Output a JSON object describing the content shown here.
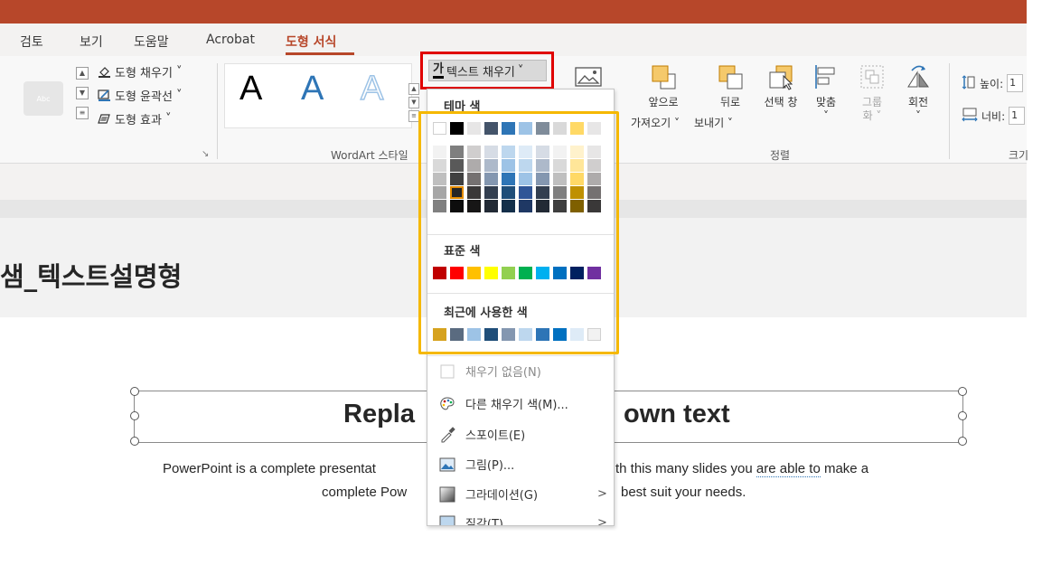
{
  "ribbon": {
    "tabs": [
      "검토",
      "보기",
      "도움말",
      "Acrobat",
      "도형 서식"
    ],
    "active_tab": "도형 서식",
    "shape_styles": {
      "fill": "도형 채우기",
      "outline": "도형 윤곽선",
      "effects": "도형 효과",
      "thumb": "Abc"
    },
    "wordart": {
      "sample": "A",
      "group_label": "WordArt 스타일"
    },
    "text_fill_button": "텍스트 채우기",
    "text_fill_glyph": "가",
    "arrange": {
      "bring_forward_1": "앞으로",
      "bring_forward_2": "가져오기 ˅",
      "send_backward_1": "뒤로",
      "send_backward_2": "보내기 ˅",
      "selection_pane": "선택 창",
      "align": "맞춤",
      "align_arrow": "˅",
      "group_1": "그룹",
      "group_2": "화 ˅",
      "rotate": "회전",
      "rotate_arrow": "˅",
      "group_label": "정렬"
    },
    "size": {
      "height_label": "높이:",
      "width_label": "너비:",
      "height_value": "1",
      "width_value": "1",
      "group_label": "크기"
    }
  },
  "slide": {
    "title": "샘_텍스트설명형",
    "headline_left": "Repla",
    "headline_right": "own text",
    "body_line1_left": "PowerPoint is a complete presentat",
    "body_line1_right_a": "th this many slides you ",
    "body_line1_right_b": "are able to",
    "body_line1_right_c": " make a",
    "body_line2_left": "complete Pow",
    "body_line2_right": "best suit your needs."
  },
  "dropdown": {
    "theme_colors_label": "테마 색",
    "standard_colors_label": "표준 색",
    "recent_colors_label": "최근에 사용한 색",
    "items": [
      {
        "label": "채우기 없음(N)",
        "icon": "empty-box-icon",
        "enabled": false
      },
      {
        "label": "다른 채우기 색(M)...",
        "icon": "palette-icon",
        "enabled": true
      },
      {
        "label": "스포이트(E)",
        "icon": "eyedropper-icon",
        "enabled": true
      },
      {
        "label": "그림(P)...",
        "icon": "picture-icon",
        "enabled": true
      },
      {
        "label": "그라데이션(G)",
        "icon": "gradient-icon",
        "enabled": true,
        "submenu": true
      },
      {
        "label": "질감(T)",
        "icon": "texture-icon",
        "enabled": true,
        "submenu": true
      }
    ],
    "submenu_arrow": ">",
    "theme_colors": [
      "#ffffff",
      "#000000",
      "#e7e6e6",
      "#44546a",
      "#2e75b6",
      "#9dc3e6",
      "#7f8c9a",
      "#d9d9d9",
      "#ffd966",
      "#e7e6e6"
    ],
    "theme_shades": [
      [
        "#f2f2f2",
        "#d9d9d9",
        "#bfbfbf",
        "#a6a6a6",
        "#808080"
      ],
      [
        "#7f7f7f",
        "#595959",
        "#404040",
        "#262626",
        "#0d0d0d"
      ],
      [
        "#d0cece",
        "#aeabab",
        "#757171",
        "#3a3838",
        "#171616"
      ],
      [
        "#d6dce5",
        "#adb9ca",
        "#8497b0",
        "#333f50",
        "#222a35"
      ],
      [
        "#bdd7ee",
        "#9dc3e6",
        "#2e75b6",
        "#1f4e79",
        "#132f4a"
      ],
      [
        "#deebf7",
        "#bdd7ee",
        "#9dc3e6",
        "#2f5597",
        "#1f3864"
      ],
      [
        "#d6dce5",
        "#adb9ca",
        "#8497b0",
        "#333f50",
        "#222a35"
      ],
      [
        "#f2f2f2",
        "#d9d9d9",
        "#bfbfbf",
        "#7f7f7f",
        "#3f3f3f"
      ],
      [
        "#fff2cc",
        "#ffe699",
        "#ffd966",
        "#bf9000",
        "#7f6000"
      ],
      [
        "#e7e6e6",
        "#d0cece",
        "#aeabab",
        "#757171",
        "#3a3838"
      ]
    ],
    "standard_colors": [
      "#c00000",
      "#ff0000",
      "#ffc000",
      "#ffff00",
      "#92d050",
      "#00b050",
      "#00b0f0",
      "#0070c0",
      "#002060",
      "#7030a0"
    ],
    "recent_colors": [
      "#d6a21e",
      "#5a6b80",
      "#9dc3e6",
      "#1f4e79",
      "#8497b0",
      "#bdd7ee",
      "#2e75b6",
      "#0070c0",
      "#deebf7",
      "#f2f2f2"
    ]
  },
  "colors": {
    "accent": "#b7472a",
    "red_highlight": "#e00000",
    "yellow_highlight": "#f5b800"
  }
}
